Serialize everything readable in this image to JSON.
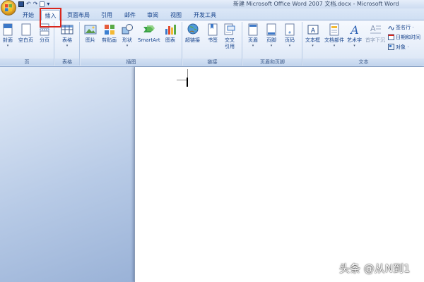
{
  "window": {
    "title": "新建 Microsoft Office Word 2007 文档.docx - Microsoft Word"
  },
  "qat": {
    "save_icon": "save-icon",
    "undo_glyph": "↶",
    "redo_glyph": "↷",
    "more_glyph": "▾"
  },
  "tabs": [
    {
      "label": "开始"
    },
    {
      "label": "插入"
    },
    {
      "label": "页面布局"
    },
    {
      "label": "引用"
    },
    {
      "label": "邮件"
    },
    {
      "label": "审阅"
    },
    {
      "label": "视图"
    },
    {
      "label": "开发工具"
    }
  ],
  "ribbon": {
    "groups": {
      "pages": {
        "label": "页",
        "buttons": [
          "封面",
          "空白页",
          "分页"
        ]
      },
      "tables": {
        "label": "表格",
        "buttons": [
          "表格"
        ]
      },
      "illustrations": {
        "label": "插图",
        "buttons": [
          "图片",
          "剪贴画",
          "形状",
          "SmartArt",
          "图表"
        ]
      },
      "links": {
        "label": "链接",
        "buttons": [
          "超链接",
          "书签",
          "交叉",
          "引用"
        ]
      },
      "header_footer": {
        "label": "页眉和页脚",
        "buttons": [
          "页眉",
          "页脚",
          "页码"
        ]
      },
      "text": {
        "label": "文本",
        "buttons": [
          "文本框",
          "文档部件",
          "艺术字",
          "首字下沉"
        ],
        "small": [
          "签名行 ·",
          "日期和时间",
          "对象 ·"
        ]
      }
    }
  },
  "watermark": "头条 @从N到1",
  "colors": {
    "accent": "#15428b",
    "highlight": "#d9261c",
    "ribbon_bg": "#e8effa"
  }
}
